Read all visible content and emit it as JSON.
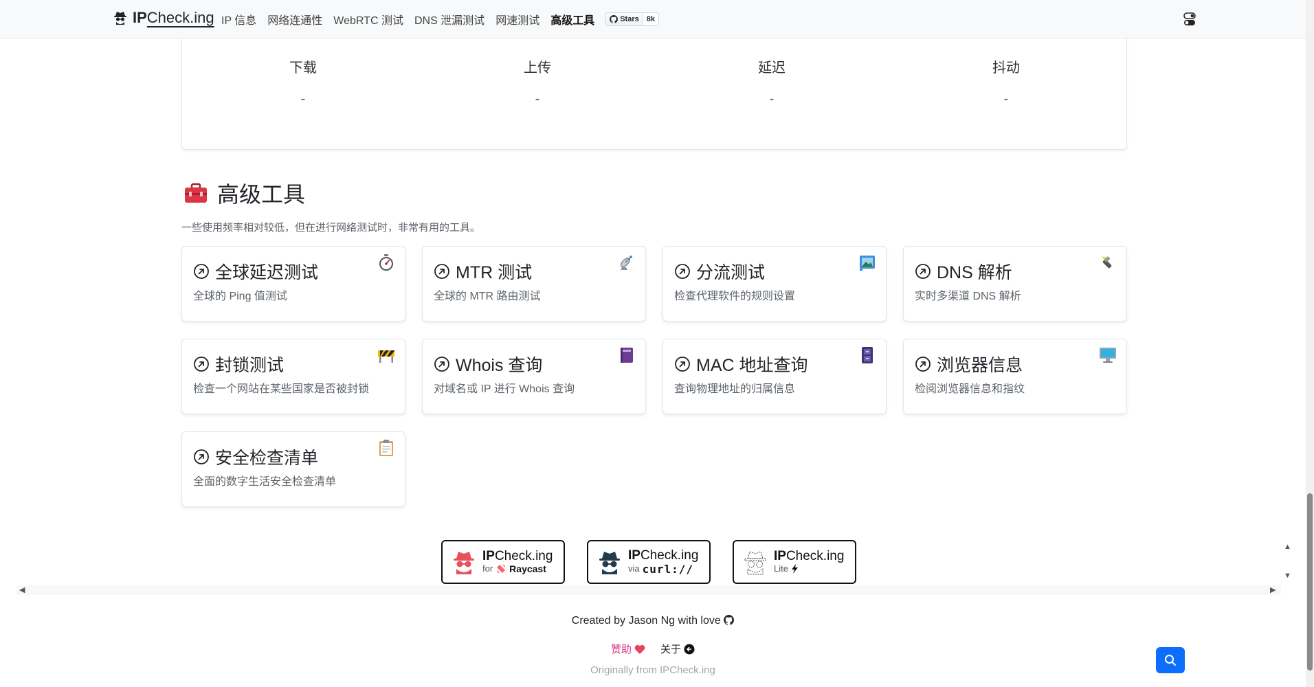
{
  "navbar": {
    "brand_strong": "IP",
    "brand_light": "Check.ing",
    "items": [
      {
        "label": "IP 信息"
      },
      {
        "label": "网络连通性"
      },
      {
        "label": "WebRTC 测试"
      },
      {
        "label": "DNS 泄漏测试"
      },
      {
        "label": "网速测试"
      },
      {
        "label": "高级工具"
      }
    ],
    "github_stars_label": "Stars",
    "github_stars_count": "8k"
  },
  "speed": {
    "items": [
      {
        "label": "下载",
        "value": "-"
      },
      {
        "label": "上传",
        "value": "-"
      },
      {
        "label": "延迟",
        "value": "-"
      },
      {
        "label": "抖动",
        "value": "-"
      }
    ]
  },
  "advanced": {
    "title": "高级工具",
    "description": "一些使用频率相对较低，但在进行网络测试时，非常有用的工具。",
    "tools": [
      {
        "title": "全球延迟测试",
        "desc": "全球的 Ping 值测试",
        "icon": "stopwatch-icon"
      },
      {
        "title": "MTR 测试",
        "desc": "全球的 MTR 路由测试",
        "icon": "satellite-antenna-icon"
      },
      {
        "title": "分流测试",
        "desc": "检查代理软件的规则设置",
        "icon": "framed-picture-icon"
      },
      {
        "title": "DNS 解析",
        "desc": "实时多渠道 DNS 解析",
        "icon": "flashlight-icon"
      },
      {
        "title": "封锁测试",
        "desc": "检查一个网站在某些国家是否被封锁",
        "icon": "construction-barrier-icon"
      },
      {
        "title": "Whois 查询",
        "desc": "对域名或 IP 进行 Whois 查询",
        "icon": "notebook-icon"
      },
      {
        "title": "MAC 地址查询",
        "desc": "查询物理地址的归属信息",
        "icon": "file-cabinet-icon"
      },
      {
        "title": "浏览器信息",
        "desc": "检阅浏览器信息和指纹",
        "icon": "desktop-computer-icon"
      },
      {
        "title": "安全检查清单",
        "desc": "全面的数字生活安全检查清单",
        "icon": "clipboard-icon"
      }
    ]
  },
  "apps": [
    {
      "name_strong": "IP",
      "name_light": "Check.ing",
      "sub_prefix": "for",
      "sub_main": "Raycast",
      "color": "#e8505b"
    },
    {
      "name_strong": "IP",
      "name_light": "Check.ing",
      "sub_prefix": "via",
      "sub_main": "curl://",
      "color": "#1f3b4d"
    },
    {
      "name_strong": "IP",
      "name_light": "Check.ing",
      "sub_prefix": "Lite",
      "sub_main": "",
      "color": "#ffffff"
    }
  ],
  "footer": {
    "created": "Created by Jason Ng with love",
    "sponsor": "赞助",
    "about": "关于",
    "origin": "Originally from IPCheck.ing"
  },
  "colors": {
    "primary": "#0d6efd",
    "sponsor": "#d63384",
    "toolbox": "#dc3545"
  }
}
